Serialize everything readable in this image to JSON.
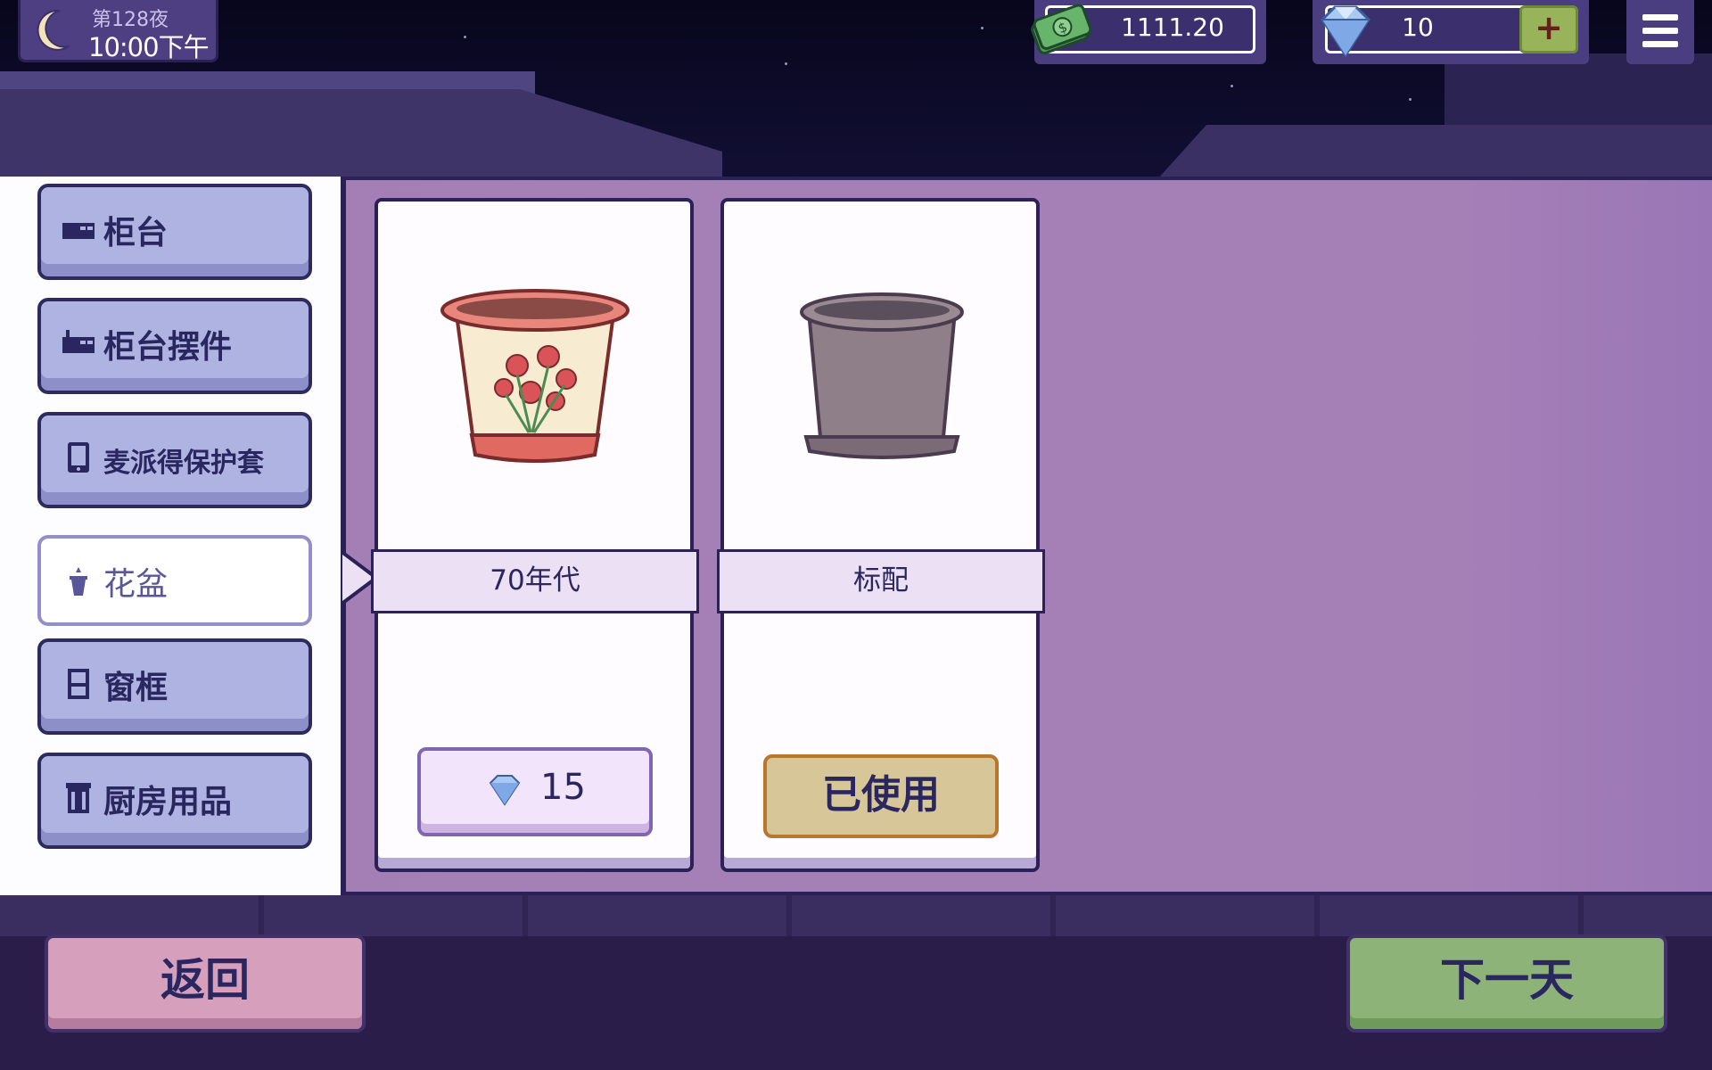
{
  "hud": {
    "night": "第128夜",
    "clock": "10:00下午",
    "money": "1111.20",
    "gems": "10",
    "plus_label": "+"
  },
  "categories": [
    {
      "label": "柜台",
      "icon": "counter-icon",
      "active": false
    },
    {
      "label": "柜台摆件",
      "icon": "counter-decor-icon",
      "active": false
    },
    {
      "label": "麦派得保护套",
      "icon": "tablet-icon",
      "active": false
    },
    {
      "label": "花盆",
      "icon": "flowerpot-icon",
      "active": true
    },
    {
      "label": "窗框",
      "icon": "window-icon",
      "active": false
    },
    {
      "label": "厨房用品",
      "icon": "kitchen-icon",
      "active": false
    }
  ],
  "items": [
    {
      "name": "70年代",
      "price": "15",
      "status": "purchasable"
    },
    {
      "name": "标配",
      "status_label": "已使用",
      "status": "in-use"
    }
  ],
  "footer": {
    "back_label": "返回",
    "next_label": "下一天"
  },
  "colors": {
    "panel": "#a47fb6",
    "outline": "#2c2156",
    "category_button": "#afb3e1",
    "back_button": "#d69fbc",
    "next_button": "#8db378",
    "used_button": "#d7c698"
  }
}
